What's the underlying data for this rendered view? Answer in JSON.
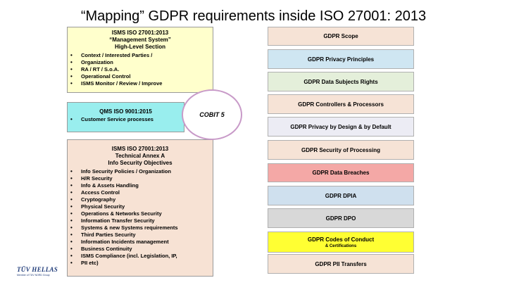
{
  "title": "“Mapping” GDPR requirements inside ISO 27001: 2013",
  "left": {
    "isms_high": {
      "header": [
        "ISMS ISO 27001:2013",
        "“Management System”",
        "High-Level Section"
      ],
      "items": [
        "Context / Interested Parties /",
        "Organization",
        "RA / RT / S.o.A.",
        "Operational Control",
        "ISMS Monitor / Review / Improve"
      ]
    },
    "qms": {
      "header": "QMS ISO 9001:2015",
      "items": [
        "Customer Service processes"
      ]
    },
    "isms_annex": {
      "header": [
        "ISMS ISO 27001:2013",
        "Technical Annex A",
        "Info Security Objectives"
      ],
      "items": [
        "Info Security Policies / Organization",
        "H/R Security",
        "Info & Assets Handling",
        "Access Control",
        "Cryptography",
        "Physical Security",
        "Operations & Networks Security",
        "Information Transfer Security",
        "Systems & new Systems requirements",
        "Third Parties Security",
        "Information Incidents management",
        "Business Continuity",
        "ISMS Compliance (incl. Legislation, IP,",
        "PII etc)"
      ]
    }
  },
  "cobit": "COBIT 5",
  "right": [
    {
      "label": "GDPR Scope",
      "color": "#f6e3d6"
    },
    {
      "label": "GDPR Privacy Principles",
      "color": "#cfe6f2"
    },
    {
      "label": "GDPR Data Subjects Rights",
      "color": "#e4efda"
    },
    {
      "label": "GDPR Controllers & Processors",
      "color": "#f6e3d6"
    },
    {
      "label": "GDPR Privacy by Design & by Default",
      "color": "#ececf4"
    },
    {
      "label": "GDPR Security of Processing",
      "color": "#f6e3d6"
    },
    {
      "label": "GDPR Data Breaches",
      "color": "#f4a8a6"
    },
    {
      "label": "GDPR DPIA",
      "color": "#cfe0ee"
    },
    {
      "label": "GDPR DPO",
      "color": "#d8d8d8"
    },
    {
      "label": "GDPR Codes of Conduct",
      "sub": "& Certifications",
      "color": "#ffff33"
    },
    {
      "label": "GDPR PII Transfers",
      "color": "#f6e3d6"
    }
  ],
  "logo": {
    "name": "TÜV HELLAS",
    "tagline": "Member of TÜV NORD Group"
  }
}
